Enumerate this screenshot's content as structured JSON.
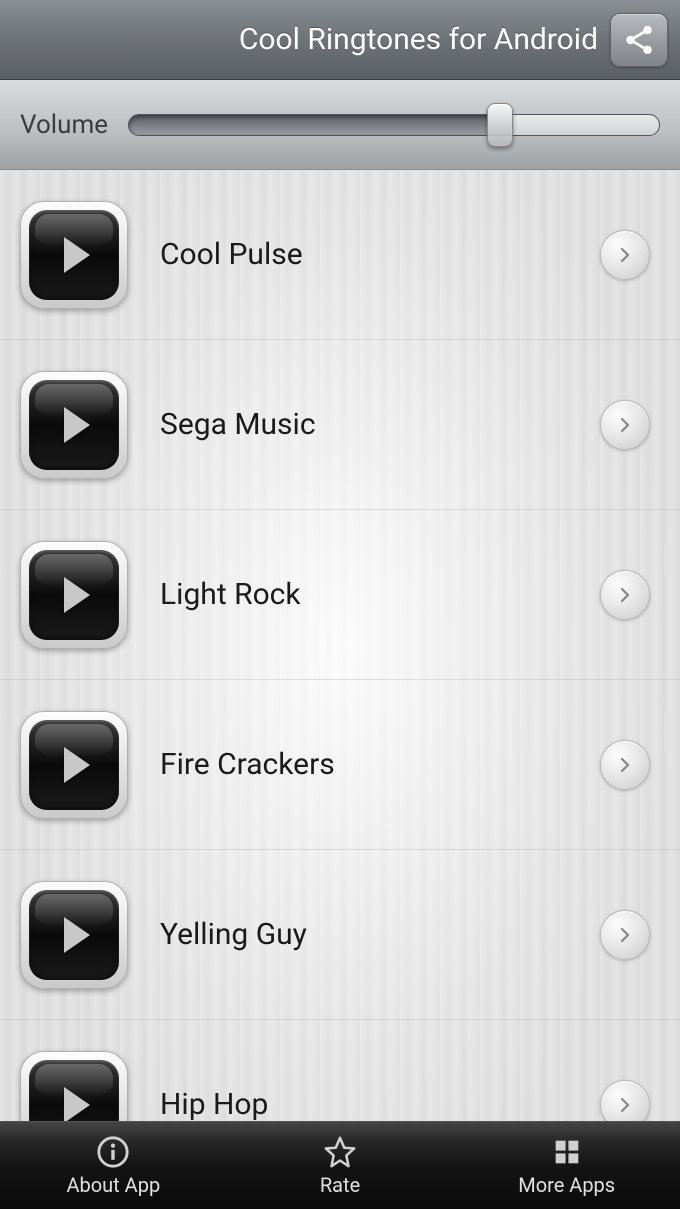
{
  "header": {
    "title": "Cool Ringtones for Android"
  },
  "volume": {
    "label": "Volume",
    "percent": 70
  },
  "ringtones": [
    {
      "label": "Cool Pulse"
    },
    {
      "label": "Sega Music"
    },
    {
      "label": "Light Rock"
    },
    {
      "label": "Fire Crackers"
    },
    {
      "label": "Yelling Guy"
    },
    {
      "label": "Hip Hop"
    }
  ],
  "nav": {
    "about": "About App",
    "rate": "Rate",
    "more": "More Apps"
  }
}
